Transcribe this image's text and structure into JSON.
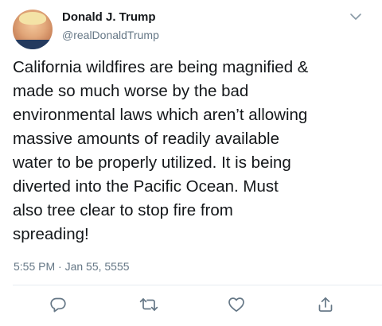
{
  "tweet": {
    "author_name": "Donald J. Trump",
    "author_handle": "@realDonaldTrump",
    "text": "California wildfires are being magnified &\nmade so much worse by the bad\nenvironmental laws which aren’t allowing\nmassive amounts of readily available\nwater to be properly utilized. It is being\ndiverted into the Pacific Ocean. Must\nalso tree clear to stop fire from\nspreading!",
    "timestamp": "5:55 PM · Jan 55, 5555"
  },
  "icons": {
    "menu": "chevron-down-icon",
    "reply": "reply-icon",
    "retweet": "retweet-icon",
    "like": "heart-icon",
    "share": "share-icon"
  },
  "colors": {
    "text": "#14171a",
    "secondary": "#657786",
    "icon": "#657786",
    "divider": "#e6ecf0"
  }
}
